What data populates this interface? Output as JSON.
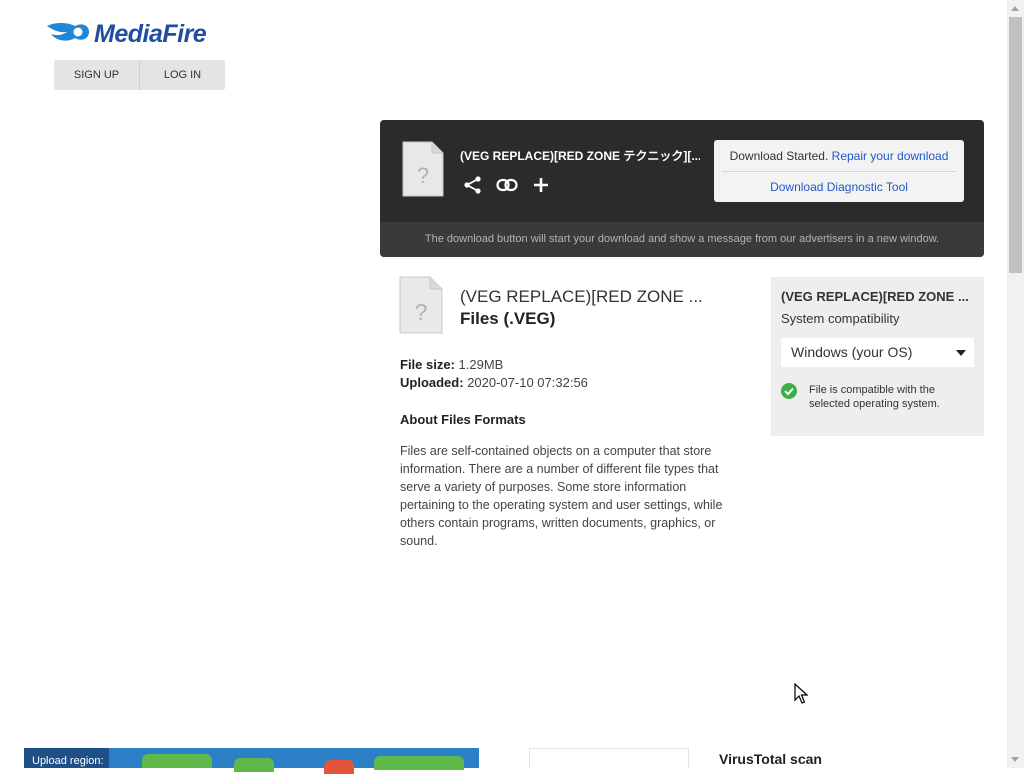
{
  "header": {
    "logo_text": "MediaFire",
    "sign_up": "SIGN UP",
    "log_in": "LOG IN"
  },
  "download_panel": {
    "file_title": "(VEG REPLACE)[RED ZONE テクニック][...",
    "status_prefix": "Download Started. ",
    "repair_link": "Repair your download",
    "diagnostic_link": "Download Diagnostic Tool",
    "footer_note": "The download button will start your download and show a message from our advertisers in a new window.",
    "icons": [
      "share-icon",
      "link-icon",
      "plus-icon"
    ]
  },
  "file_info": {
    "name": "(VEG REPLACE)[RED ZONE ...",
    "type": "Files (.VEG)",
    "size_label": "File size:",
    "size_value": "1.29MB",
    "uploaded_label": "Uploaded:",
    "uploaded_value": "2020-07-10 07:32:56",
    "about_title": "About Files Formats",
    "about_text": "Files are self-contained objects on a computer that store information. There are a number of different file types that serve a variety of purposes. Some store information pertaining to the operating system and user settings, while others contain programs, written documents, graphics, or sound."
  },
  "compatibility": {
    "name": "(VEG REPLACE)[RED ZONE ...",
    "label": "System compatibility",
    "selected_os": "Windows (your OS)",
    "message": "File is compatible with the selected operating system."
  },
  "bottom": {
    "upload_region_label": "Upload region:",
    "virustotal_title": "VirusTotal scan"
  },
  "colors": {
    "brand": "#1f4ea1",
    "panel_bg": "#2b2b2b",
    "link": "#1f58c7",
    "ok_green": "#3fae49"
  }
}
